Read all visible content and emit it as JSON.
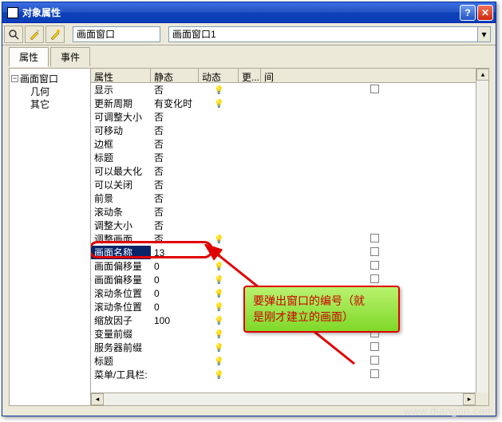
{
  "window": {
    "title": "对象属性"
  },
  "toolbar": {
    "combo1": "画面窗口",
    "combo2": "画面窗口1"
  },
  "tabs": {
    "attr": "属性",
    "event": "事件"
  },
  "tree": {
    "root": "画面窗口",
    "child1": "几何",
    "child2": "其它"
  },
  "grid": {
    "headers": {
      "attr": "属性",
      "static": "静态",
      "dynamic": "动态",
      "more": "更...",
      "interval": "间"
    },
    "rows": [
      {
        "name": "显示",
        "static": "否",
        "bulb": true,
        "chk": true
      },
      {
        "name": "更新周期",
        "static": "有变化时",
        "bulb": true,
        "chk": false
      },
      {
        "name": "可调整大小",
        "static": "否",
        "bulb": false,
        "chk": false
      },
      {
        "name": "可移动",
        "static": "否",
        "bulb": false,
        "chk": false
      },
      {
        "name": "边框",
        "static": "否",
        "bulb": false,
        "chk": false
      },
      {
        "name": "标题",
        "static": "否",
        "bulb": false,
        "chk": false
      },
      {
        "name": "可以最大化",
        "static": "否",
        "bulb": false,
        "chk": false
      },
      {
        "name": "可以关闭",
        "static": "否",
        "bulb": false,
        "chk": false
      },
      {
        "name": "前景",
        "static": "否",
        "bulb": false,
        "chk": false
      },
      {
        "name": "滚动条",
        "static": "否",
        "bulb": false,
        "chk": false
      },
      {
        "name": "调整大小",
        "static": "否",
        "bulb": false,
        "chk": false
      },
      {
        "name": "调整画面",
        "static": "否",
        "bulb": true,
        "chk": true
      },
      {
        "name": "画面名称",
        "static": "13",
        "bulb": true,
        "chk": true,
        "highlight": true
      },
      {
        "name": "画面偏移量",
        "static": "0",
        "bulb": true,
        "chk": true
      },
      {
        "name": "画面偏移量",
        "static": "0",
        "bulb": true,
        "chk": true
      },
      {
        "name": "滚动条位置",
        "static": "0",
        "bulb": true,
        "chk": true
      },
      {
        "name": "滚动条位置",
        "static": "0",
        "bulb": true,
        "chk": true
      },
      {
        "name": "缩放因子",
        "static": "100",
        "bulb": true,
        "chk": true
      },
      {
        "name": "变量前缀",
        "static": "",
        "bulb": true,
        "chk": true
      },
      {
        "name": "服务器前缀",
        "static": "",
        "bulb": true,
        "chk": true
      },
      {
        "name": "标题",
        "static": "",
        "bulb": true,
        "chk": true
      },
      {
        "name": "菜单/工具栏:",
        "static": "",
        "bulb": true,
        "chk": true
      }
    ]
  },
  "callout": {
    "line1": "要弹出窗口的编号（就",
    "line2": "是刚才建立的画面）"
  },
  "watermark": "www.diangon.com"
}
